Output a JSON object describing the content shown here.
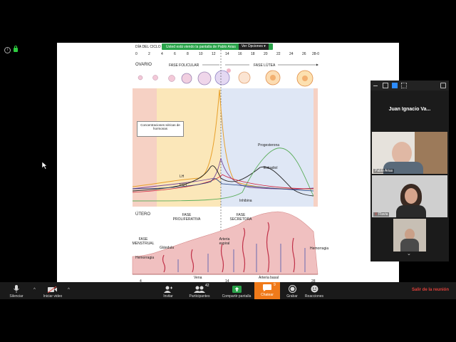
{
  "slide": {
    "banner_text": "Usted está viendo la pantalla de Pablo Arias",
    "view_options": "Ver Opciones",
    "cycle_day_label": "DÍA DEL CICLO",
    "ticks": [
      "0",
      "2",
      "4",
      "6",
      "8",
      "10",
      "12",
      "14",
      "16",
      "18",
      "20",
      "22",
      "24",
      "26",
      "28-0"
    ],
    "ovary_label": "OVARIO",
    "follicular_phase": "FASE FOLICULAR",
    "luteal_phase": "FASE LÚTEA",
    "hormone_box": "Concentraciones séricas de hormonas",
    "hormones": {
      "progesterone": "Progesterona",
      "estradiol": "Estradiol",
      "lh": "LH",
      "fsh": "FSH",
      "inhibin": "Inhibina"
    },
    "uterus_label": "ÚTERO",
    "proliferative_phase": "FASE PROLIFERATIVA",
    "secretory_phase": "FASE SECRETORA",
    "menstrual_phase": "FASE MENSTRUAL",
    "gland": "Glándula",
    "spiral_artery": "Arteria espiral",
    "hemorrhage_left": "Hemorragia",
    "hemorrhage_right": "Hemorragia",
    "vein": "Vena",
    "basal_artery": "Arteria basal",
    "bottom_ticks": [
      "4",
      "14",
      "28"
    ]
  },
  "panel": {
    "host_name": "Juan Ignacio Va...",
    "participants": [
      {
        "name": "Pablo Arias"
      },
      {
        "name": "Flavia"
      },
      {
        "name": ""
      }
    ]
  },
  "toolbar": {
    "mute": "Silenciar",
    "start_video": "Iniciar video",
    "invite": "Invitar",
    "participants": "Participantes",
    "participants_count": "42",
    "share_screen": "Compartir pantalla",
    "chat": "Chatear",
    "chat_count": "9",
    "record": "Grabar",
    "reactions": "Reacciones",
    "leave": "Salir de la reunión"
  },
  "colors": {
    "share_green": "#2aa34a",
    "chat_orange": "#f07a1a",
    "leave_red": "#e0403a"
  }
}
